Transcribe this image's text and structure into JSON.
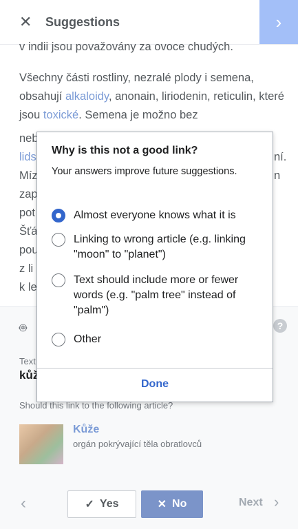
{
  "header": {
    "title": "Suggestions"
  },
  "article": {
    "line0": "v indii jsou považovány za ovoce chudých.",
    "para2_a": "Všechny části rostliny, nezralé plody i semena, obsahují ",
    "link_alkaloidy": "alkaloidy",
    "para2_b": ", anonain, liriodenin, reticulin, které jsou ",
    "link_toxicke": "toxické",
    "para2_c": ". Semena je možno bez",
    "clip_lines": [
      "neb",
      "lids",
      "Míz",
      "zap",
      "pot",
      "Šťá",
      "pou",
      "z li",
      "k le"
    ],
    "clip_right": [
      "ní.",
      "n"
    ]
  },
  "panel": {
    "text_label": "Text",
    "text_value": "kůže",
    "question": "Should this link to the following article?",
    "article_title": "Kůže",
    "article_desc": "orgán pokrývající těla obratlovců"
  },
  "actions": {
    "yes_label": "Yes",
    "no_label": "No",
    "next_label": "Next"
  },
  "dialog": {
    "title": "Why is this not a good link?",
    "subtitle": "Your answers improve future suggestions.",
    "options": [
      {
        "label": "Almost everyone knows what it is",
        "checked": true
      },
      {
        "label": "Linking to wrong article (e.g. linking \"moon\" to \"planet\")",
        "checked": false
      },
      {
        "label": "Text should include more or fewer words (e.g. \"palm tree\" instead of \"palm\")",
        "checked": false
      },
      {
        "label": "Other",
        "checked": false
      }
    ],
    "done_label": "Done"
  },
  "colors": {
    "accent": "#3366cc",
    "link": "#7b9bd6",
    "no_button": "#7b94c9",
    "next_button": "#a3bff8"
  }
}
